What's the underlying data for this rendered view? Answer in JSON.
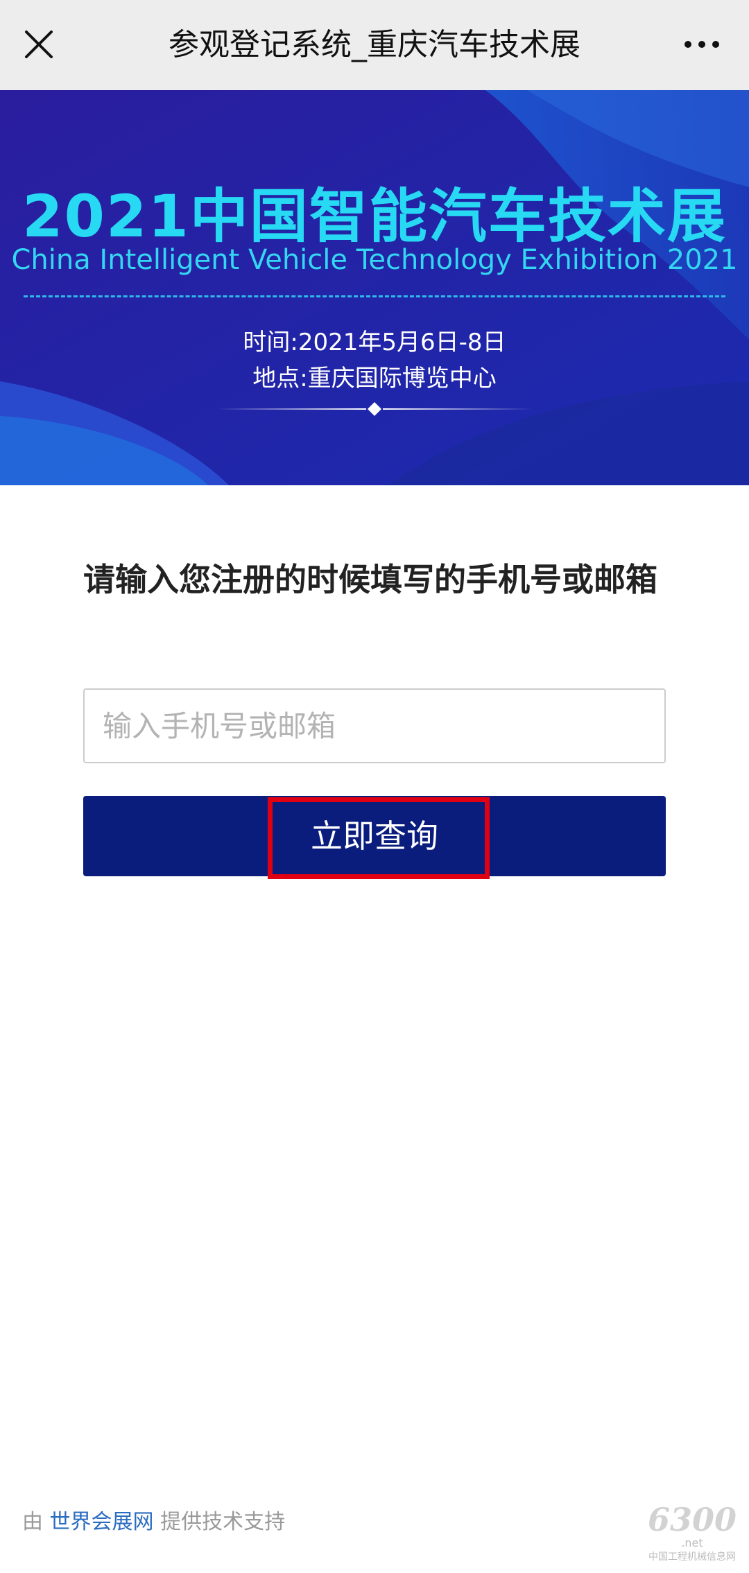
{
  "topbar": {
    "close_icon": "close-icon",
    "title": "参观登记系统_重庆汽车技术展",
    "more_icon": "more-dots-icon"
  },
  "banner": {
    "title": "2021中国智能汽车技术展",
    "subtitle": "China Intelligent Vehicle Technology Exhibition 2021",
    "time": "时间:2021年5月6日-8日",
    "place": "地点:重庆国际博览中心"
  },
  "form": {
    "prompt": "请输入您注册的时候填写的手机号或邮箱",
    "input_value": "",
    "input_placeholder": "输入手机号或邮箱",
    "query_label": "立即查询"
  },
  "footer": {
    "prefix": "由",
    "link": "世界会展网",
    "suffix": "提供技术支持"
  },
  "watermark": {
    "logo": "6300",
    "net": ".net",
    "caption": "中国工程机械信息网"
  },
  "colors": {
    "topbar_bg": "#ededed",
    "banner_title": "#27d9f3",
    "button_bg": "#0a1d7d",
    "highlight_border": "#e00012",
    "footer_link": "#2a6cc0"
  }
}
